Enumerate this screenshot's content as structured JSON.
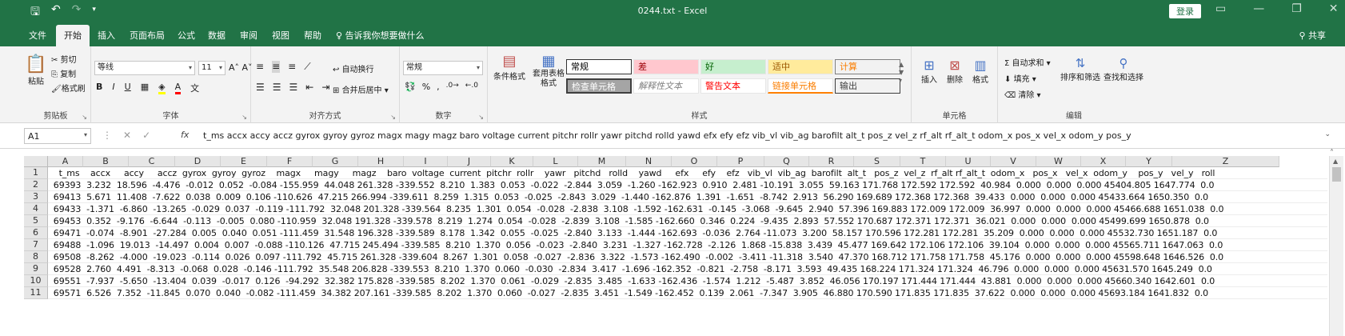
{
  "titlebar": {
    "save_icon": "save-icon",
    "undo_icon": "undo-icon",
    "redo_icon": "redo-icon",
    "title": "0244.txt - Excel",
    "login_label": "登录"
  },
  "tabs": [
    "文件",
    "开始",
    "插入",
    "页面布局",
    "公式",
    "数据",
    "审阅",
    "视图",
    "帮助",
    "告诉我你想要做什么"
  ],
  "share_label": "共享",
  "ribbon": {
    "clipboard": {
      "paste": "粘贴",
      "cut": "剪切",
      "copy": "复制",
      "format_painter": "格式刷",
      "label": "剪贴板"
    },
    "font": {
      "name": "等线",
      "size": "11",
      "bold": "B",
      "italic": "I",
      "underline": "U",
      "label": "字体"
    },
    "alignment": {
      "wrap": "自动换行",
      "merge": "合并后居中",
      "label": "对齐方式"
    },
    "number": {
      "format": "常规",
      "percent": "%",
      "comma": ",",
      "label": "数字"
    },
    "styles": {
      "conditional": "条件格式",
      "table": "套用表格格式",
      "cells": [
        {
          "text": "常规",
          "bg": "#ffffff",
          "color": "#000000",
          "border": "#333333"
        },
        {
          "text": "差",
          "bg": "#ffc7ce",
          "color": "#9c0006",
          "border": "#e6e6e6"
        },
        {
          "text": "好",
          "bg": "#c6efce",
          "color": "#006100",
          "border": "#e6e6e6"
        },
        {
          "text": "适中",
          "bg": "#ffeb9c",
          "color": "#9c5700",
          "border": "#e6e6e6"
        },
        {
          "text": "计算",
          "bg": "#f2f2f2",
          "color": "#fa7d00",
          "border": "#7f7f7f"
        },
        {
          "text": "检查单元格",
          "bg": "#a5a5a5",
          "color": "#ffffff",
          "border": "#3f3f3f"
        },
        {
          "text": "解释性文本",
          "bg": "#ffffff",
          "color": "#7f7f7f",
          "border": "#e6e6e6"
        },
        {
          "text": "警告文本",
          "bg": "#ffffff",
          "color": "#ff0000",
          "border": "#e6e6e6"
        },
        {
          "text": "链接单元格",
          "bg": "#ffffff",
          "color": "#fa7d00",
          "border": "#e6e6e6"
        },
        {
          "text": "输出",
          "bg": "#f2f2f2",
          "color": "#3f3f3f",
          "border": "#3f3f3f"
        }
      ],
      "label": "样式"
    },
    "cells_group": {
      "insert": "插入",
      "delete": "删除",
      "format": "格式",
      "label": "单元格"
    },
    "editing": {
      "autosum": "自动求和",
      "fill": "填充",
      "clear": "清除",
      "sort": "排序和筛选",
      "find": "查找和选择",
      "label": "编辑"
    }
  },
  "formula_bar": {
    "name_box": "A1",
    "fx": "fx",
    "formula": "t_ms   accx   accy   accz  gyrox  gyroy  gyroz   magx   magy   magz   baro  voltage  current  pitchr  rollr  yawr  pitchd  rolld   yawd    efx    efy    efz  vib_vl  vib_ag  barofilt   alt_t   pos_z   vel_z  rf_alt  rf_alt_t  odom_x   pos_x   vel_x  odom_y   pos_y"
  },
  "columns": [
    "A",
    "B",
    "C",
    "D",
    "E",
    "F",
    "G",
    "H",
    "I",
    "J",
    "K",
    "L",
    "M",
    "N",
    "O",
    "P",
    "Q",
    "R",
    "S",
    "T",
    "U",
    "V",
    "W",
    "X",
    "Y",
    "Z"
  ],
  "row_numbers": [
    "1",
    "2",
    "3",
    "4",
    "5",
    "6",
    "7",
    "8",
    "9",
    "10",
    "11"
  ],
  "rows": [
    "    t_ms    accx     accy     accz  gyrox  gyroy  gyroz    magx     magy     magz    baro  voltage  current  pitchr  rollr    yawr   pitchd   rolld    yawd     efx     efy    efz   vib_vl  vib_ag  barofilt  alt_t   pos_z  vel_z  rf_alt rf_alt_t  odom_x   pos_x   vel_x  odom_y    pos_y   vel_y   roll",
    "  69393  3.232  18.596  -4.476  -0.012  0.052  -0.084 -155.959  44.048 261.328 -339.552  8.210  1.383  0.053  -0.022  -2.844  3.059  -1.260 -162.923  0.910  2.481 -10.191  3.055  59.163 171.768 172.592 172.592  40.984  0.000  0.000  0.000 45404.805 1647.774  0.0",
    "  69413  5.671  11.408  -7.622  0.038  0.009  0.106 -110.626  47.215 266.994 -339.611  8.259  1.315  0.053  -0.025  -2.843  3.029  -1.440 -162.876  1.391  -1.651  -8.742  2.913  56.290 169.689 172.368 172.368  39.433  0.000  0.000  0.000 45433.664 1650.350  0.0",
    "  69433  -1.371  -6.860  -13.265  -0.029  0.037  -0.119 -111.792  32.048 201.328 -339.564  8.235  1.301  0.054  -0.028  -2.838  3.108  -1.592 -162.631  -0.145  -3.068  -9.645  2.940  57.396 169.883 172.009 172.009  36.997  0.000  0.000  0.000 45466.688 1651.038  0.0",
    "  69453  0.352  -9.176  -6.644  -0.113  -0.005  0.080 -110.959  32.048 191.328 -339.578  8.219  1.274  0.054  -0.028  -2.839  3.108  -1.585 -162.660  0.346  0.224  -9.435  2.893  57.552 170.687 172.371 172.371  36.021  0.000  0.000  0.000 45499.699 1650.878  0.0",
    "  69471  -0.074  -8.901  -27.284  0.005  0.040  0.051 -111.459  31.548 196.328 -339.589  8.178  1.342  0.055  -0.025  -2.840  3.133  -1.444 -162.693  -0.036  2.764 -11.073  3.200  58.157 170.596 172.281 172.281  35.209  0.000  0.000  0.000 45532.730 1651.187  0.0",
    "  69488  -1.096  19.013  -14.497  0.004  0.007  -0.088 -110.126  47.715 245.494 -339.585  8.210  1.370  0.056  -0.023  -2.840  3.231  -1.327 -162.728  -2.126  1.868 -15.838  3.439  45.477 169.642 172.106 172.106  39.104  0.000  0.000  0.000 45565.711 1647.063  0.0",
    "  69508  -8.262  -4.000  -19.023  -0.114  0.026  0.097 -111.792  45.715 261.328 -339.604  8.267  1.301  0.058  -0.027  -2.836  3.322  -1.573 -162.490  -0.002  -3.411 -11.318  3.540  47.370 168.712 171.758 171.758  45.176  0.000  0.000  0.000 45598.648 1646.526  0.0",
    "  69528  2.760  4.491  -8.313  -0.068  0.028  -0.146 -111.792  35.548 206.828 -339.553  8.210  1.370  0.060  -0.030  -2.834  3.417  -1.696 -162.352  -0.821  -2.758  -8.171  3.593  49.435 168.224 171.324 171.324  46.796  0.000  0.000  0.000 45631.570 1645.249  0.0",
    "  69551  -7.937  -5.650  -13.404  0.039  -0.017  0.126  -94.292  32.382 175.828 -339.585  8.202  1.370  0.061  -0.029  -2.835  3.485  -1.633 -162.436  -1.574  1.212  -5.487  3.852  46.056 170.197 171.444 171.444  43.881  0.000  0.000  0.000 45660.340 1642.601  0.0",
    "  69571  6.526  7.352  -11.845  0.070  0.040  -0.082 -111.459  34.382 207.161 -339.585  8.202  1.370  0.060  -0.027  -2.835  3.451  -1.549 -162.452  0.139  2.061  -7.347  3.905  46.880 170.590 171.835 171.835  37.622  0.000  0.000  0.000 45693.184 1641.832  0.0"
  ]
}
